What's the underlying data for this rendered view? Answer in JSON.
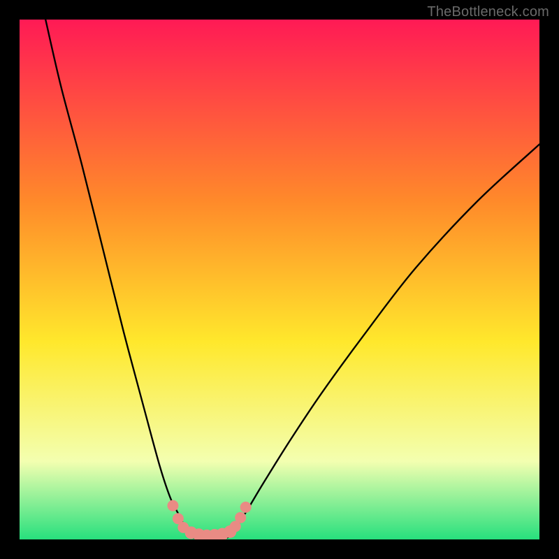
{
  "watermark": "TheBottleneck.com",
  "chart_data": {
    "type": "line",
    "title": "",
    "xlabel": "",
    "ylabel": "",
    "xlim": [
      0,
      100
    ],
    "ylim": [
      0,
      100
    ],
    "background_gradient": {
      "top_color": "#ff1a55",
      "mid_top_color": "#ff8a2a",
      "mid_color": "#ffe82c",
      "mid_bottom_color": "#f3ffb0",
      "bottom_color": "#27e07d"
    },
    "series": [
      {
        "name": "curve-left",
        "x": [
          5,
          8,
          12,
          16,
          20,
          24,
          27,
          29,
          30.5,
          31.5,
          32,
          32.5,
          33
        ],
        "y": [
          100,
          87,
          72,
          56,
          40,
          25,
          14,
          8,
          5,
          3,
          2,
          1,
          0.4
        ]
      },
      {
        "name": "valley-floor",
        "x": [
          33,
          34,
          35,
          36,
          37,
          38,
          39,
          40
        ],
        "y": [
          0.4,
          0.2,
          0.15,
          0.1,
          0.1,
          0.15,
          0.2,
          0.4
        ]
      },
      {
        "name": "curve-right",
        "x": [
          40,
          41,
          42,
          44,
          47,
          52,
          58,
          66,
          76,
          88,
          100
        ],
        "y": [
          0.4,
          1.2,
          2.8,
          6,
          11,
          19,
          28,
          39,
          52,
          65,
          76
        ]
      }
    ],
    "markers": {
      "name": "highlight-dots",
      "color": "#e98b84",
      "points": [
        {
          "x": 29.5,
          "y": 6.5,
          "r": 8
        },
        {
          "x": 30.5,
          "y": 4.0,
          "r": 8
        },
        {
          "x": 31.5,
          "y": 2.3,
          "r": 8
        },
        {
          "x": 33.0,
          "y": 1.3,
          "r": 9
        },
        {
          "x": 34.5,
          "y": 0.9,
          "r": 9
        },
        {
          "x": 36.0,
          "y": 0.7,
          "r": 9
        },
        {
          "x": 37.5,
          "y": 0.8,
          "r": 9
        },
        {
          "x": 39.0,
          "y": 1.0,
          "r": 9
        },
        {
          "x": 40.5,
          "y": 1.5,
          "r": 9
        },
        {
          "x": 41.5,
          "y": 2.5,
          "r": 8
        },
        {
          "x": 42.5,
          "y": 4.2,
          "r": 8
        },
        {
          "x": 43.5,
          "y": 6.2,
          "r": 8
        }
      ]
    }
  }
}
